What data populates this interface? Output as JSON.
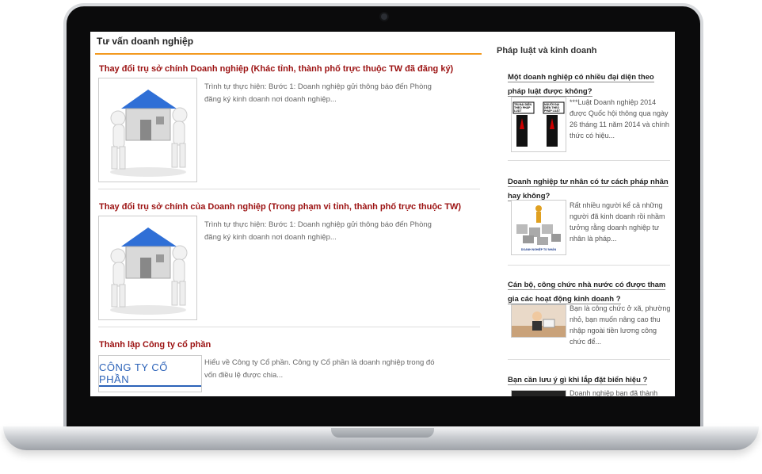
{
  "left_section": {
    "title": "Tư vấn doanh nghiệp",
    "articles": [
      {
        "title": "Thay đổi trụ sở chính Doanh nghiệp (Khác tỉnh, thành phố trực thuộc TW đã đăng ký)",
        "summary": "Trình tự thực hiện: Bước 1: Doanh nghiệp gửi thông báo đến Phòng đăng ký kinh doanh nơi doanh nghiệp..."
      },
      {
        "title": "Thay đổi trụ sở chính của Doanh nghiệp (Trong phạm vi tỉnh, thành phố trực thuộc TW)",
        "summary": "Trình tự thực hiện: Bước 1: Doanh nghiệp gửi thông báo đến Phòng đăng ký kinh doanh nơi doanh nghiệp..."
      },
      {
        "title": "Thành lập Công ty cổ phần",
        "summary": "Hiểu về Công ty Cổ phần. Công ty Cổ phần là doanh nghiệp trong đó vốn điều lệ được chia...",
        "thumb_text": "CÔNG TY CỔ PHẦN"
      }
    ]
  },
  "right_section": {
    "title": "Pháp luật và kinh doanh",
    "items": [
      {
        "title": "Một doanh nghiệp có nhiều đại diện theo pháp luật được không?",
        "summary": "***Luật Doanh nghiệp 2014 được Quốc hội thông qua ngày 26 tháng 11 năm 2014 và chính thức có hiệu...",
        "thumb_left": "TRỊ ĐẠI DIỆN THEO PHÁP LUẬT",
        "thumb_right": "NGƯỜI ĐẠI DIỆN THEO PHÁP LUẬT"
      },
      {
        "title": "Doanh nghiệp tư nhân có tư cách pháp nhân hay không?",
        "summary": "Rất nhiều người kể cả những người đã kinh doanh rồi nhầm tưởng rằng doanh nghiệp tư nhân là pháp...",
        "thumb_caption": "DOANH NGHIỆP TƯ NHÂN"
      },
      {
        "title": "Cán bộ, công chức nhà nước có được tham gia các hoạt động kinh doanh ?",
        "summary": "Bạn là công chức ở xã, phường nhỏ, bạn muốn nâng cao thu nhập ngoài tiền lương công chức để..."
      },
      {
        "title": "Bạn cần lưu ý gì khi lắp đặt biển hiệu ?",
        "summary": "Doanh nghiệp bạn đã thành"
      }
    ]
  }
}
